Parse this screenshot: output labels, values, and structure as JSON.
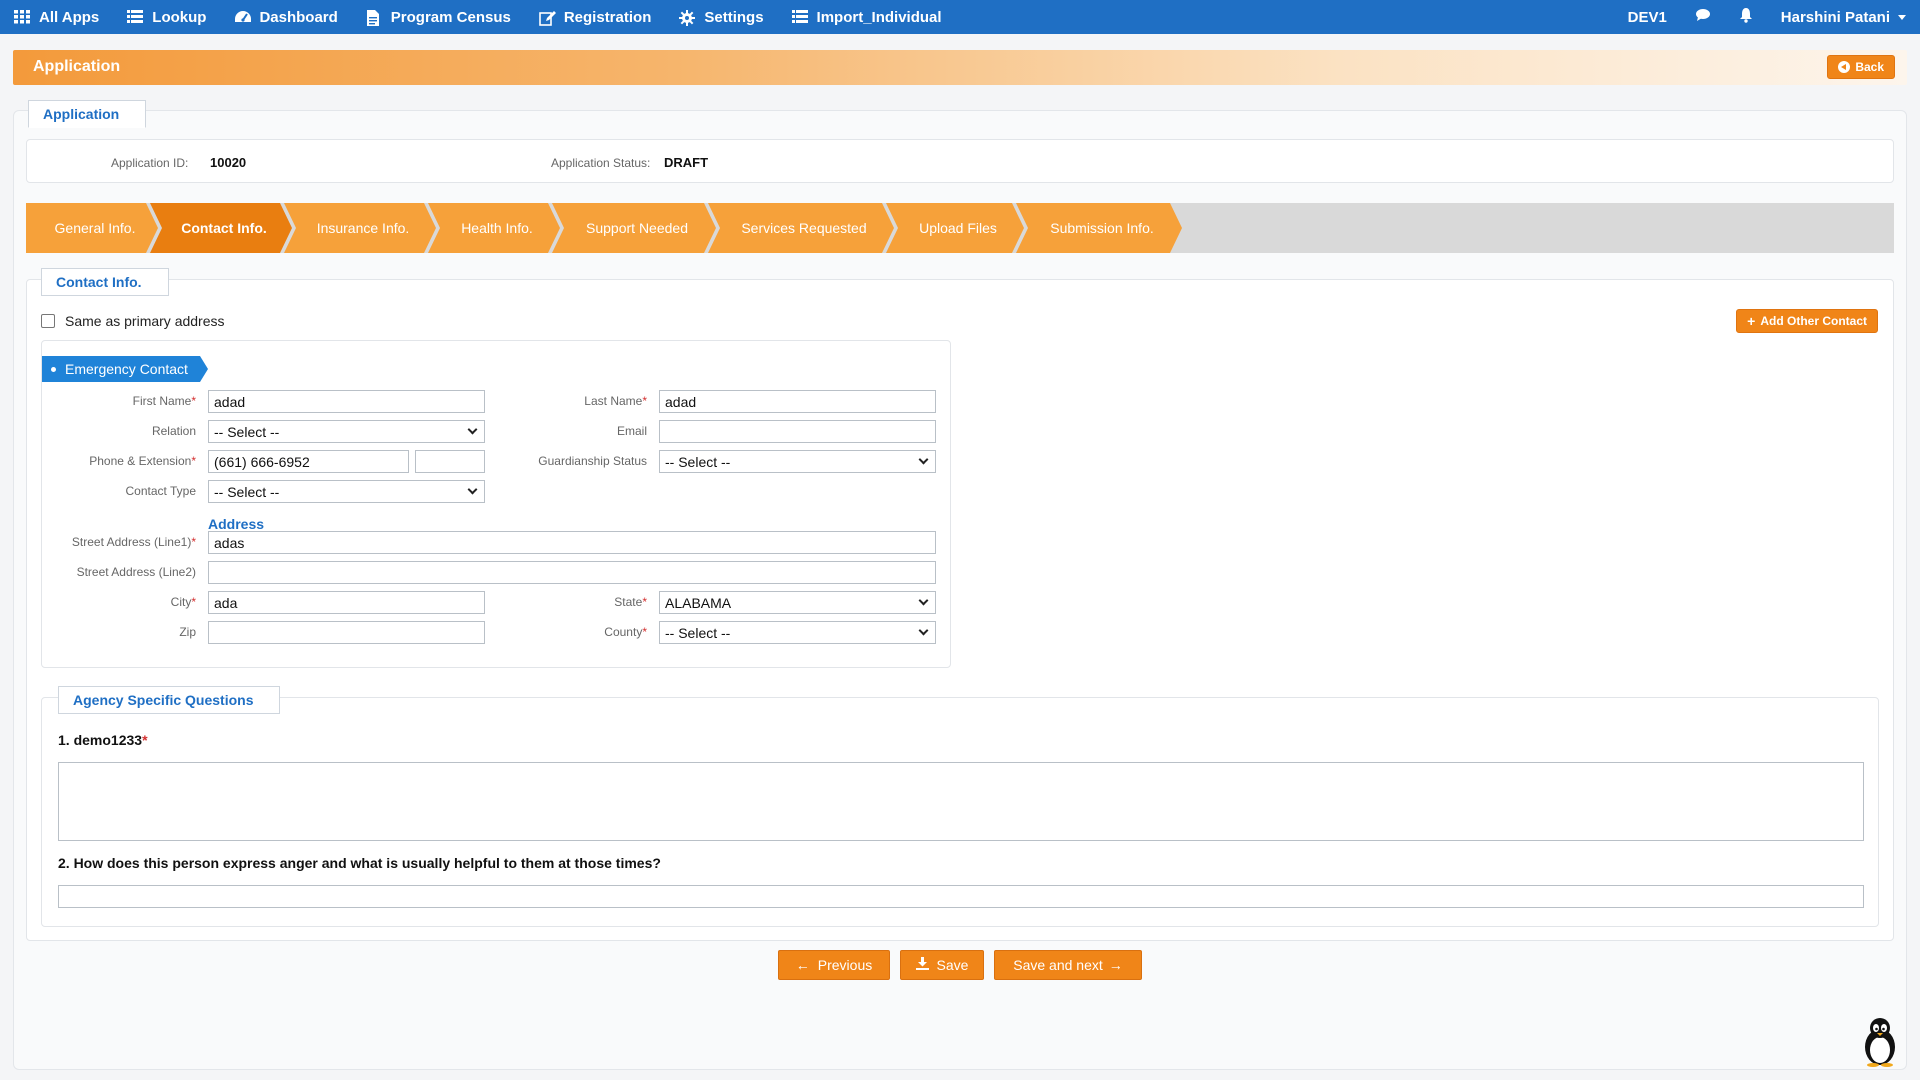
{
  "nav": {
    "items": [
      {
        "label": "All Apps",
        "icon": "grid-icon"
      },
      {
        "label": "Lookup",
        "icon": "list-icon"
      },
      {
        "label": "Dashboard",
        "icon": "dashboard-icon"
      },
      {
        "label": "Program Census",
        "icon": "document-icon"
      },
      {
        "label": "Registration",
        "icon": "edit-icon"
      },
      {
        "label": "Settings",
        "icon": "gear-icon"
      },
      {
        "label": "Import_Individual",
        "icon": "list-icon"
      }
    ],
    "env": "DEV1",
    "user": "Harshini Patani"
  },
  "header": {
    "title": "Application",
    "back_label": "Back"
  },
  "application": {
    "tab_label": "Application",
    "id_label": "Application ID:",
    "id_value": "10020",
    "status_label": "Application Status:",
    "status_value": "DRAFT"
  },
  "steps": [
    {
      "label": "General Info."
    },
    {
      "label": "Contact Info.",
      "active": true
    },
    {
      "label": "Insurance Info."
    },
    {
      "label": "Health Info."
    },
    {
      "label": "Support Needed"
    },
    {
      "label": "Services Requested"
    },
    {
      "label": "Upload Files"
    },
    {
      "label": "Submission Info."
    }
  ],
  "contact": {
    "tab_label": "Contact Info.",
    "same_as_primary_label": "Same as primary address",
    "add_other_label": "Add Other Contact",
    "emergency_label": "Emergency Contact",
    "first_name_label": "First Name",
    "first_name_value": "adad",
    "last_name_label": "Last Name",
    "last_name_value": "adad",
    "relation_label": "Relation",
    "relation_value": "-- Select --",
    "email_label": "Email",
    "email_value": "",
    "phone_label": "Phone & Extension",
    "phone_value": "(661) 666-6952",
    "extension_value": "",
    "guardianship_label": "Guardianship Status",
    "guardianship_value": "-- Select --",
    "contact_type_label": "Contact Type",
    "contact_type_value": "-- Select --",
    "address_heading": "Address",
    "street1_label": "Street Address (Line1)",
    "street1_value": "adas",
    "street2_label": "Street Address (Line2)",
    "street2_value": "",
    "city_label": "City",
    "city_value": "ada",
    "state_label": "State",
    "state_value": "ALABAMA",
    "zip_label": "Zip",
    "zip_value": "",
    "county_label": "County",
    "county_value": "-- Select --",
    "required_mark": "*"
  },
  "agency": {
    "tab_label": "Agency Specific Questions",
    "q1": "1. demo1233",
    "q2": "2. How does this person express anger and what is usually helpful to them at those times?"
  },
  "footer": {
    "previous_label": "Previous",
    "save_label": "Save",
    "save_next_label": "Save and next"
  },
  "colors": {
    "nav": "#1f6fc4",
    "orange": "#f08518",
    "step": "#f6a13a",
    "step_active": "#e97e10",
    "ribbon": "#1f83d8"
  }
}
